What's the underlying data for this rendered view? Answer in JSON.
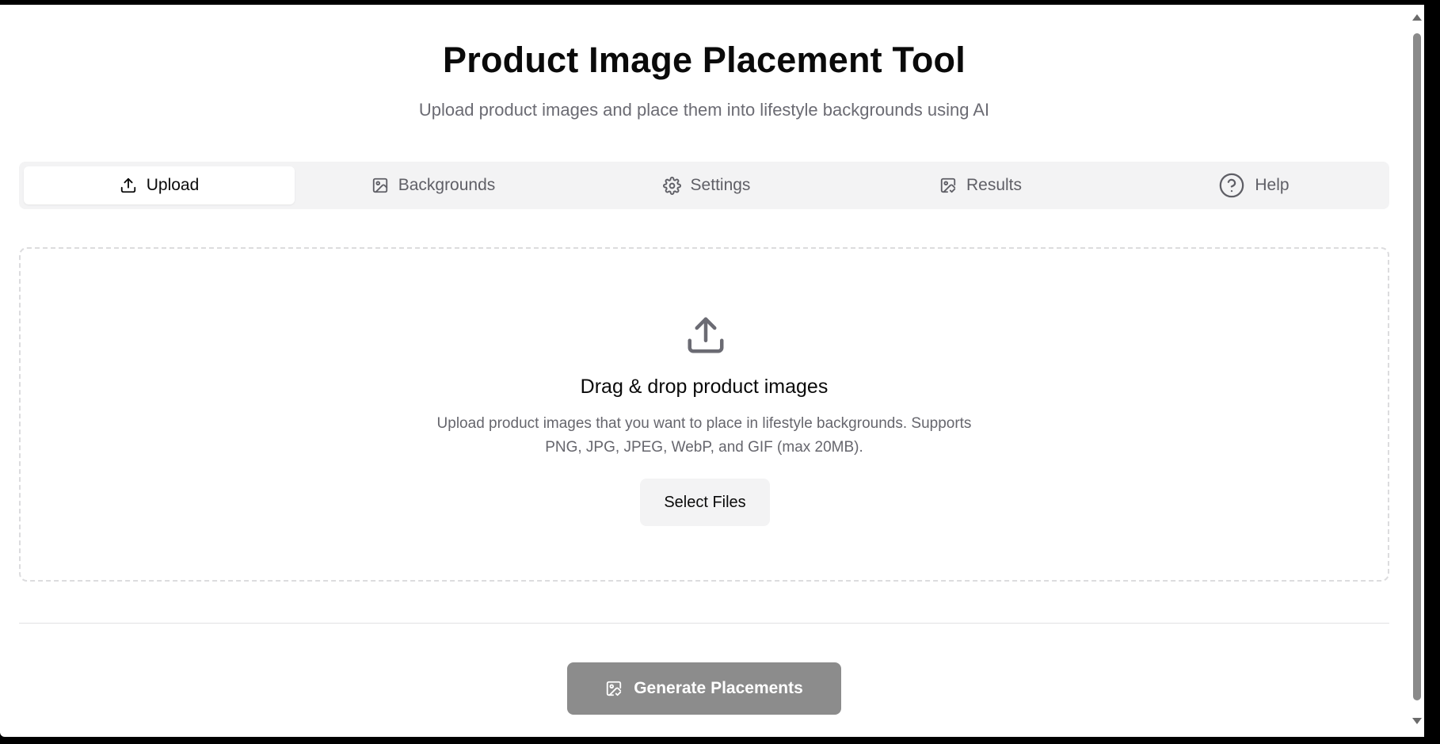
{
  "header": {
    "title": "Product Image Placement Tool",
    "subtitle": "Upload product images and place them into lifestyle backgrounds using AI"
  },
  "tabs": [
    {
      "label": "Upload",
      "icon": "upload-icon",
      "active": true
    },
    {
      "label": "Backgrounds",
      "icon": "image-icon",
      "active": false
    },
    {
      "label": "Settings",
      "icon": "gear-icon",
      "active": false
    },
    {
      "label": "Results",
      "icon": "image-check-icon",
      "active": false
    },
    {
      "label": "Help",
      "icon": "help-circle-icon",
      "active": false
    }
  ],
  "dropzone": {
    "icon": "upload-icon",
    "title": "Drag & drop product images",
    "description": "Upload product images that you want to place in lifestyle backgrounds. Supports PNG, JPG, JPEG, WebP, and GIF (max 20MB).",
    "button_label": "Select Files"
  },
  "footer": {
    "generate_label": "Generate Placements",
    "generate_icon": "image-check-icon"
  },
  "colors": {
    "tab_bar_bg": "#f3f3f4",
    "generate_bg": "#8c8c8c",
    "muted_text": "#6b6b73"
  }
}
